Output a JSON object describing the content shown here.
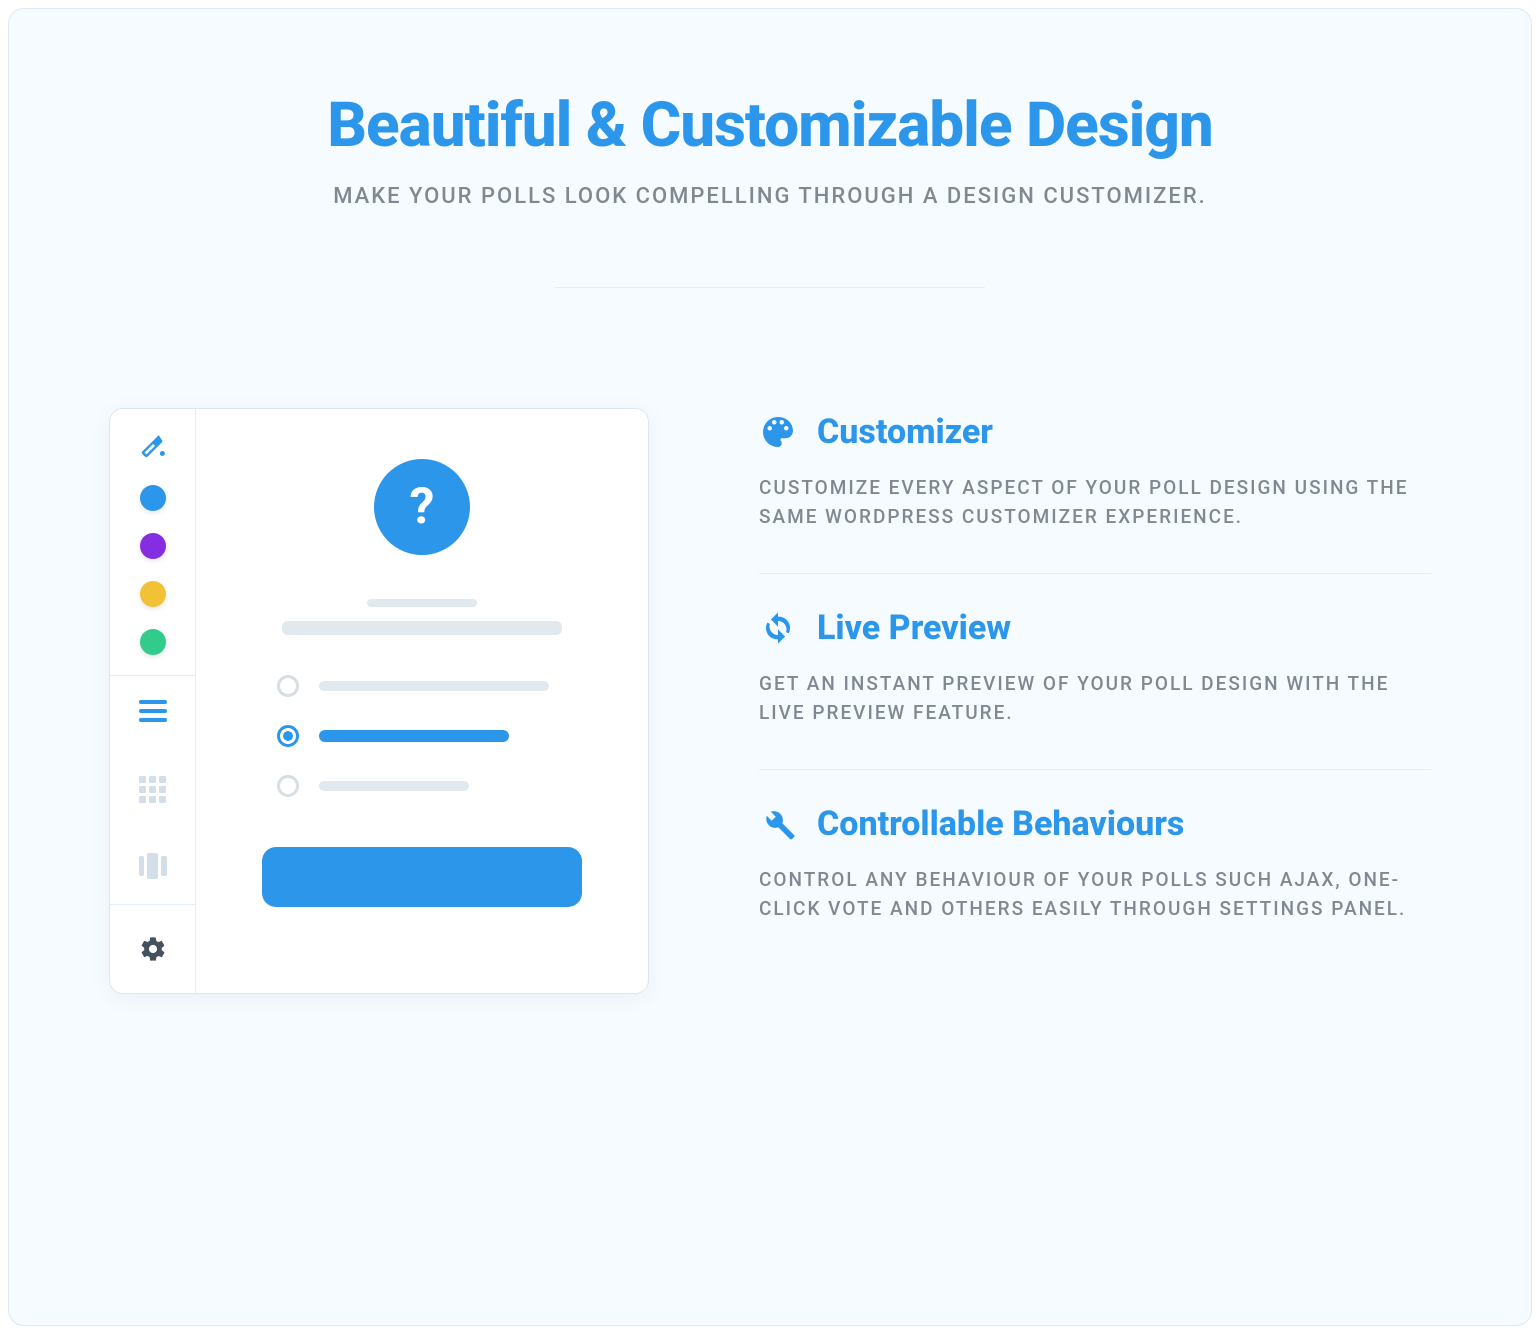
{
  "heading": {
    "title": "Beautiful & Customizable Design",
    "subtitle": "Make your polls look compelling through a design customizer."
  },
  "mock": {
    "swatches": [
      "blue",
      "purple",
      "orange",
      "green"
    ],
    "question_mark": "?"
  },
  "features": [
    {
      "icon": "palette-icon",
      "title": "Customizer",
      "desc": "Customize every aspect of your poll design using the same WordPress customizer experience."
    },
    {
      "icon": "refresh-icon",
      "title": "Live Preview",
      "desc": "Get an instant preview of your poll design with the live preview feature."
    },
    {
      "icon": "wrench-icon",
      "title": "Controllable Behaviours",
      "desc": "Control any behaviour of your polls such AJAX, one-click vote and others easily through settings panel."
    }
  ]
}
